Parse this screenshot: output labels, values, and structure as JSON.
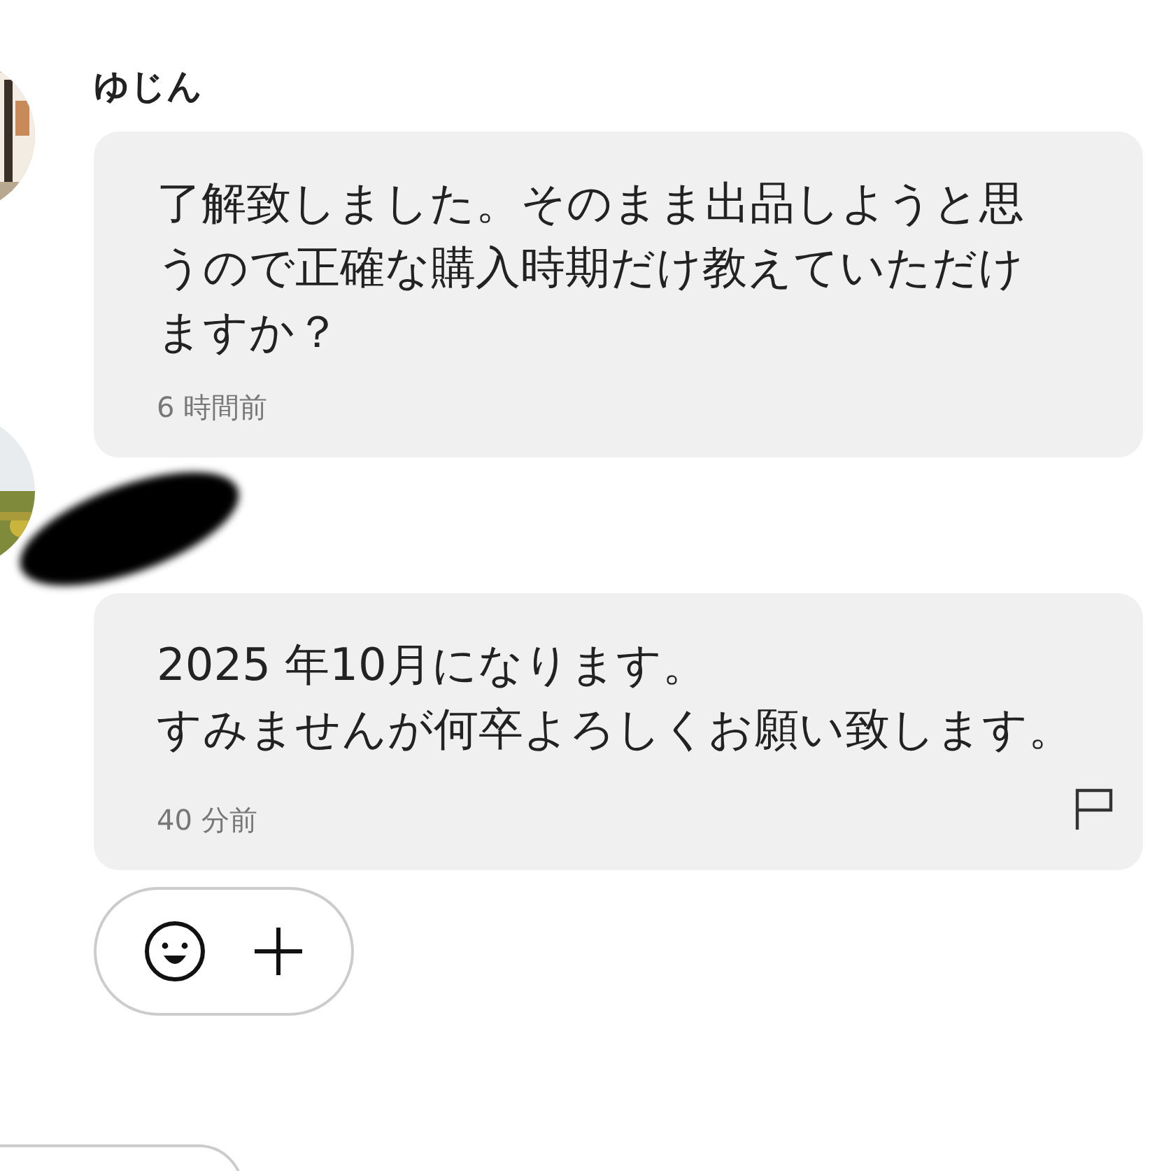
{
  "messages": [
    {
      "name": "ゆじん",
      "name_redacted": false,
      "lines": [
        "了解致しました。そのまま出品しようと思",
        "うので正確な購入時期だけ教えていただけ",
        "ますか？"
      ],
      "time": "6 時間前",
      "report_flag": false
    },
    {
      "name_redacted": true,
      "lines": [
        "2025 年10月になります。",
        "すみませんが何卒よろしくお願い致します。"
      ],
      "time": "40 分前",
      "report_flag": true
    }
  ]
}
